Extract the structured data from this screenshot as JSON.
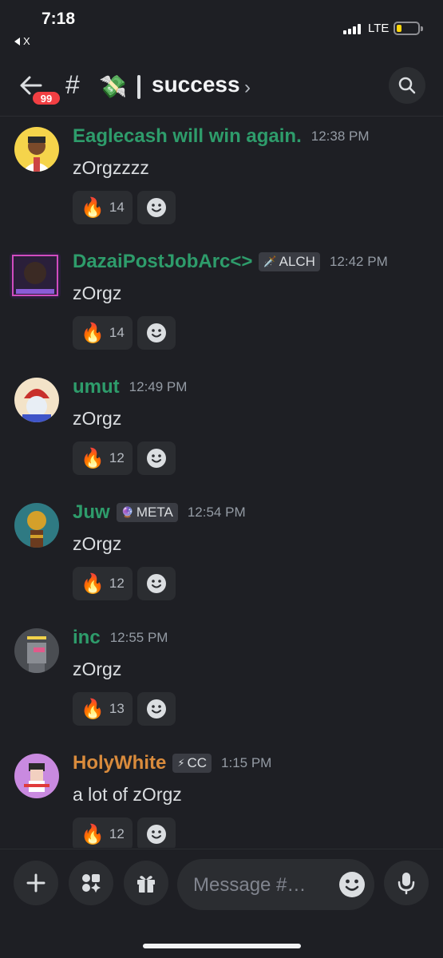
{
  "status_bar": {
    "time": "7:18",
    "back_app": "X",
    "network": "LTE"
  },
  "header": {
    "back_badge": "99",
    "hash": "#",
    "channel_emoji": "💸",
    "channel_name": "success",
    "chevron": "›"
  },
  "messages": [
    {
      "username": "Eaglecash will win again.",
      "name_color": "green",
      "role": "",
      "role_icon": "",
      "time": "12:38 PM",
      "text": "zOrgzzzz",
      "reaction_emoji": "🔥",
      "reaction_count": "14"
    },
    {
      "username": "DazaiPostJobArc<>",
      "name_color": "green",
      "role": "ALCH",
      "role_icon": "🗡️",
      "time": "12:42 PM",
      "text": "zOrgz",
      "reaction_emoji": "🔥",
      "reaction_count": "14"
    },
    {
      "username": "umut",
      "name_color": "green",
      "role": "",
      "role_icon": "",
      "time": "12:49 PM",
      "text": "zOrgz",
      "reaction_emoji": "🔥",
      "reaction_count": "12"
    },
    {
      "username": "Juw",
      "name_color": "green",
      "role": "META",
      "role_icon": "🔮",
      "time": "12:54 PM",
      "text": "zOrgz",
      "reaction_emoji": "🔥",
      "reaction_count": "12"
    },
    {
      "username": "inc",
      "name_color": "green",
      "role": "",
      "role_icon": "",
      "time": "12:55 PM",
      "text": "zOrgz",
      "reaction_emoji": "🔥",
      "reaction_count": "13"
    },
    {
      "username": "HolyWhite",
      "name_color": "orange",
      "role": "CC",
      "role_icon": "⚡",
      "time": "1:15 PM",
      "text": "a lot of zOrgz",
      "reaction_emoji": "🔥",
      "reaction_count": "12"
    }
  ],
  "composer": {
    "placeholder": "Message #…"
  },
  "colors": {
    "background": "#1e1f24",
    "green_name": "#2e9c6b",
    "orange_name": "#d98b3c",
    "badge_red": "#f23f43"
  }
}
